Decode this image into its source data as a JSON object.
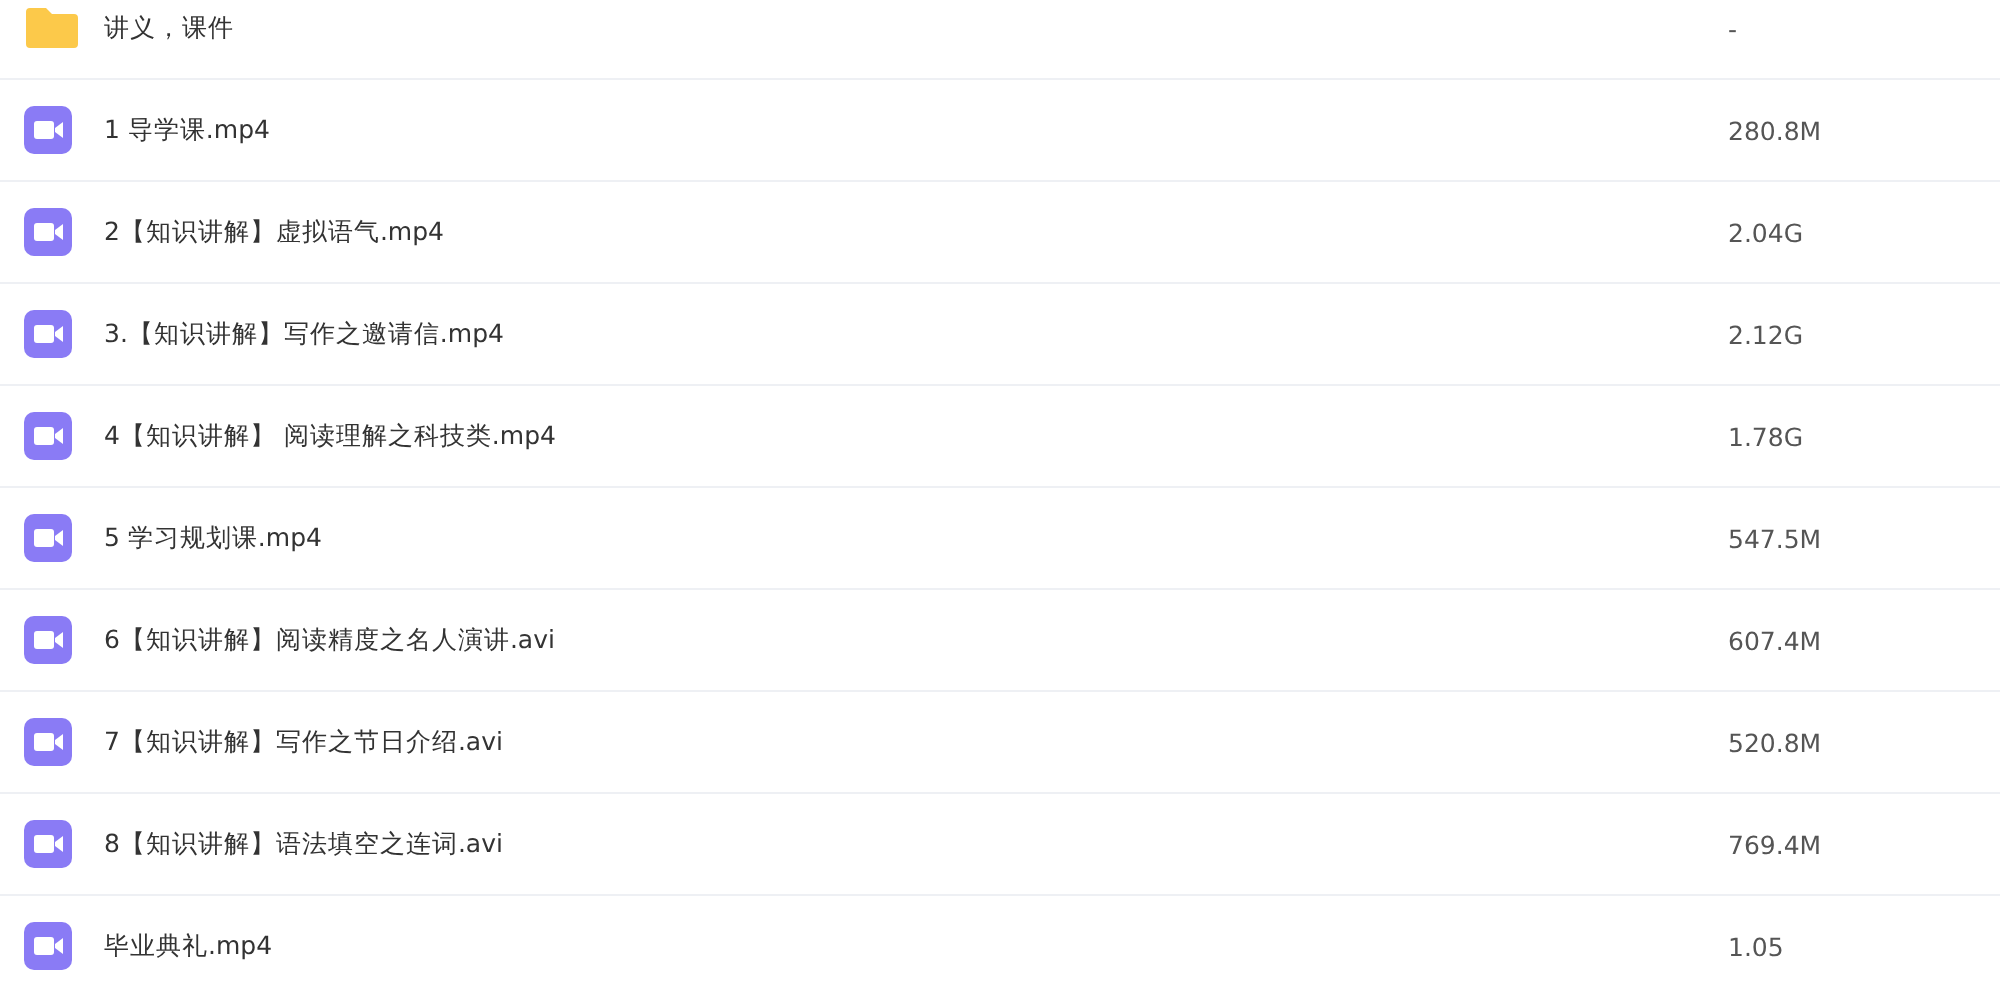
{
  "files": [
    {
      "kind": "folder",
      "name": "讲义，课件",
      "size": "-"
    },
    {
      "kind": "video",
      "name": "1 导学课.mp4",
      "size": "280.8M"
    },
    {
      "kind": "video",
      "name": "2【知识讲解】虚拟语气.mp4",
      "size": "2.04G"
    },
    {
      "kind": "video",
      "name": "3.【知识讲解】写作之邀请信.mp4",
      "size": "2.12G"
    },
    {
      "kind": "video",
      "name": "4【知识讲解】 阅读理解之科技类.mp4",
      "size": "1.78G"
    },
    {
      "kind": "video",
      "name": "5 学习规划课.mp4",
      "size": "547.5M"
    },
    {
      "kind": "video",
      "name": "6【知识讲解】阅读精度之名人演讲.avi",
      "size": "607.4M"
    },
    {
      "kind": "video",
      "name": "7【知识讲解】写作之节日介绍.avi",
      "size": "520.8M"
    },
    {
      "kind": "video",
      "name": "8【知识讲解】语法填空之连词.avi",
      "size": "769.4M"
    },
    {
      "kind": "video",
      "name": "毕业典礼.mp4",
      "size": "1.05"
    }
  ]
}
